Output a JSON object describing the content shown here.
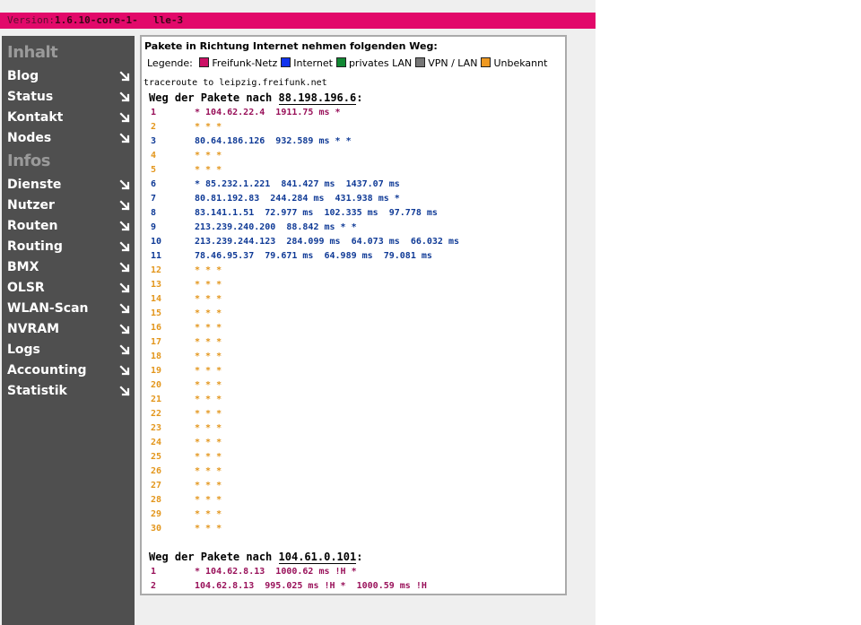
{
  "header": {
    "version_label": "Version:",
    "version_value": "1.6.10-core-1-",
    "version_extra": "lle-3"
  },
  "sidebar": {
    "sections": [
      {
        "title": "Inhalt",
        "items": [
          "Blog",
          "Status",
          "Kontakt",
          "Nodes"
        ]
      },
      {
        "title": "Infos",
        "items": [
          "Dienste",
          "Nutzer",
          "Routen",
          "Routing",
          "BMX",
          "OLSR",
          "WLAN-Scan",
          "NVRAM",
          "Logs",
          "Accounting",
          "Statistik"
        ]
      }
    ]
  },
  "main": {
    "intro": "Pakete in Richtung Internet nehmen folgenden Weg:",
    "legend_label": "Legende:",
    "legend": [
      {
        "label": "Freifunk-Netz",
        "color": "#cc1166"
      },
      {
        "label": "Internet",
        "color": "#1133ee"
      },
      {
        "label": "privates LAN",
        "color": "#118833"
      },
      {
        "label": "VPN / LAN",
        "color": "#777777"
      },
      {
        "label": "Unbekannt",
        "color": "#ee9922"
      }
    ],
    "traceroute_header": "traceroute to leipzig.freifunk.net",
    "dest_prefix": "Weg der Pakete nach",
    "colors": {
      "freifunk": "#99115a",
      "internet": "#0f3a96",
      "unknown": "#e3961c"
    },
    "traces": [
      {
        "dest": "88.198.196.6",
        "hops": [
          {
            "n": "1",
            "text": "* 104.62.22.4  1911.75 ms *",
            "type": "freifunk"
          },
          {
            "n": "2",
            "text": "* * *",
            "type": "unknown"
          },
          {
            "n": "3",
            "text": "80.64.186.126  932.589 ms * *",
            "type": "internet"
          },
          {
            "n": "4",
            "text": "* * *",
            "type": "unknown"
          },
          {
            "n": "5",
            "text": "* * *",
            "type": "unknown"
          },
          {
            "n": "6",
            "text": "* 85.232.1.221  841.427 ms  1437.07 ms",
            "type": "internet"
          },
          {
            "n": "7",
            "text": "80.81.192.83  244.284 ms  431.938 ms *",
            "type": "internet"
          },
          {
            "n": "8",
            "text": "83.141.1.51  72.977 ms  102.335 ms  97.778 ms",
            "type": "internet"
          },
          {
            "n": "9",
            "text": "213.239.240.200  88.842 ms * *",
            "type": "internet"
          },
          {
            "n": "10",
            "text": "213.239.244.123  284.099 ms  64.073 ms  66.032 ms",
            "type": "internet"
          },
          {
            "n": "11",
            "text": "78.46.95.37  79.671 ms  64.989 ms  79.081 ms",
            "type": "internet"
          },
          {
            "n": "12",
            "text": "* * *",
            "type": "unknown"
          },
          {
            "n": "13",
            "text": "* * *",
            "type": "unknown"
          },
          {
            "n": "14",
            "text": "* * *",
            "type": "unknown"
          },
          {
            "n": "15",
            "text": "* * *",
            "type": "unknown"
          },
          {
            "n": "16",
            "text": "* * *",
            "type": "unknown"
          },
          {
            "n": "17",
            "text": "* * *",
            "type": "unknown"
          },
          {
            "n": "18",
            "text": "* * *",
            "type": "unknown"
          },
          {
            "n": "19",
            "text": "* * *",
            "type": "unknown"
          },
          {
            "n": "20",
            "text": "* * *",
            "type": "unknown"
          },
          {
            "n": "21",
            "text": "* * *",
            "type": "unknown"
          },
          {
            "n": "22",
            "text": "* * *",
            "type": "unknown"
          },
          {
            "n": "23",
            "text": "* * *",
            "type": "unknown"
          },
          {
            "n": "24",
            "text": "* * *",
            "type": "unknown"
          },
          {
            "n": "25",
            "text": "* * *",
            "type": "unknown"
          },
          {
            "n": "26",
            "text": "* * *",
            "type": "unknown"
          },
          {
            "n": "27",
            "text": "* * *",
            "type": "unknown"
          },
          {
            "n": "28",
            "text": "* * *",
            "type": "unknown"
          },
          {
            "n": "29",
            "text": "* * *",
            "type": "unknown"
          },
          {
            "n": "30",
            "text": "* * *",
            "type": "unknown"
          }
        ]
      },
      {
        "dest": "104.61.0.101",
        "hops": [
          {
            "n": "1",
            "text": "* 104.62.8.13  1000.62 ms !H *",
            "type": "freifunk"
          },
          {
            "n": "2",
            "text": "104.62.8.13  995.025 ms !H *  1000.59 ms !H",
            "type": "freifunk"
          }
        ]
      }
    ]
  }
}
